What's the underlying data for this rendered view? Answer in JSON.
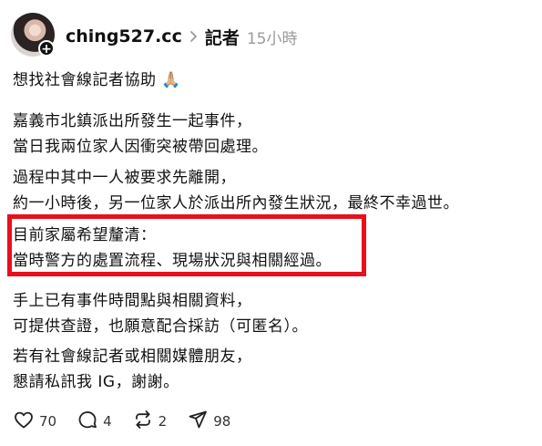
{
  "header": {
    "username": "ching527.cc",
    "tag": "記者",
    "time": "15小時"
  },
  "body": {
    "intro": "想找社會線記者協助",
    "intro_emoji": "🙏🏼",
    "para2": [
      "嘉義市北鎮派出所發生一起事件，",
      "當日我兩位家人因衝突被帶回處理。"
    ],
    "para3": [
      "過程中其中一人被要求先離開，",
      "約一小時後，另一位家人於派出所內發生狀況，最終不幸過世。"
    ],
    "para4": [
      "目前家屬希望釐清：",
      "當時警方的處置流程、現場狀況與相關經過。"
    ],
    "para5": [
      "手上已有事件時間點與相關資料，",
      "可提供查證，也願意配合採訪（可匿名）。"
    ],
    "para6": [
      "若有社會線記者或相關媒體朋友，",
      "懇請私訊我 IG，謝謝。"
    ]
  },
  "actions": {
    "likes": "70",
    "comments": "4",
    "reposts": "2",
    "shares": "98"
  },
  "colors": {
    "highlight": "#e8101b",
    "muted": "#9a9a9a"
  },
  "icons": [
    "heart-icon",
    "comment-icon",
    "repost-icon",
    "share-icon",
    "more-icon",
    "chevron-right-icon",
    "plus-icon"
  ]
}
